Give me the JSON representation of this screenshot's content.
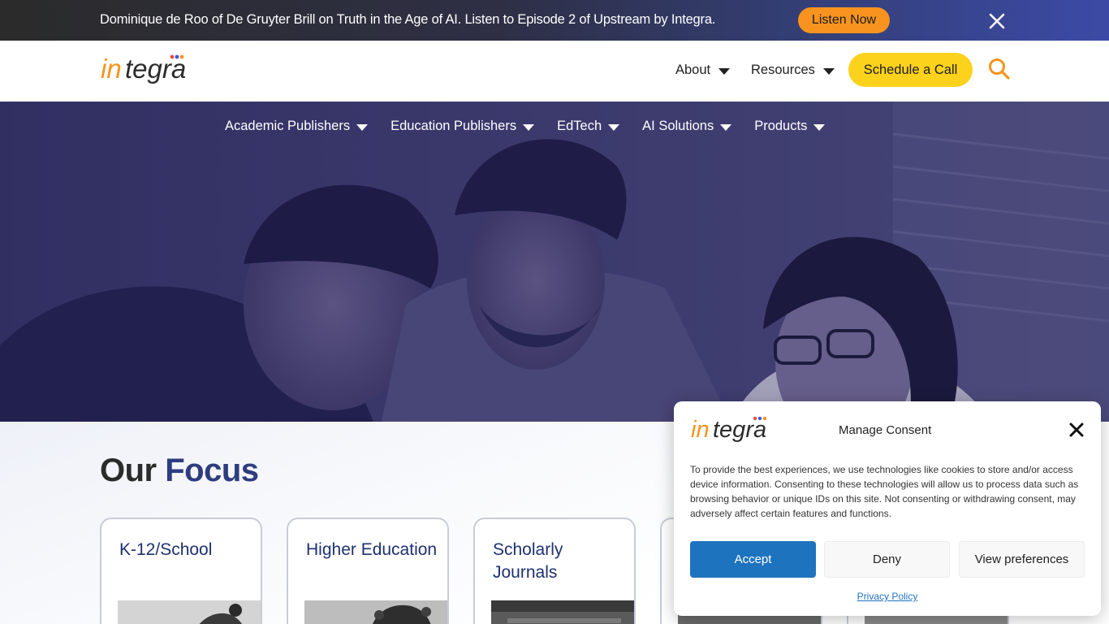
{
  "announcement": {
    "text": "Dominique de Roo of De Gruyter Brill on Truth in the Age of AI. Listen to Episode 2 of Upstream by Integra.",
    "button_label": "Listen Now",
    "close_icon": "close-icon",
    "button_color": "#f7931e"
  },
  "header": {
    "logo_text": "integra",
    "nav": [
      {
        "label": "About"
      },
      {
        "label": "Resources"
      }
    ],
    "cta_label": "Schedule a Call",
    "cta_color": "#fcd21c",
    "search_icon": "search-icon"
  },
  "subnav": [
    {
      "label": "Academic Publishers"
    },
    {
      "label": "Education Publishers"
    },
    {
      "label": "EdTech"
    },
    {
      "label": "AI Solutions"
    },
    {
      "label": "Products"
    }
  ],
  "focus": {
    "title_plain": "Our",
    "title_accent": "Focus",
    "cards": [
      {
        "title": "K-12/School"
      },
      {
        "title": "Higher Education"
      },
      {
        "title": "Scholarly Journals"
      }
    ]
  },
  "consent": {
    "logo_text": "integra",
    "title": "Manage Consent",
    "body": "To provide the best experiences, we use technologies like cookies to store and/or access device information. Consenting to these technologies will allow us to process data such as browsing behavior or unique IDs on this site. Not consenting or withdrawing consent, may adversely affect certain features and functions.",
    "accept_label": "Accept",
    "deny_label": "Deny",
    "preferences_label": "View preferences",
    "privacy_label": "Privacy Policy",
    "accept_color": "#1e73be"
  }
}
